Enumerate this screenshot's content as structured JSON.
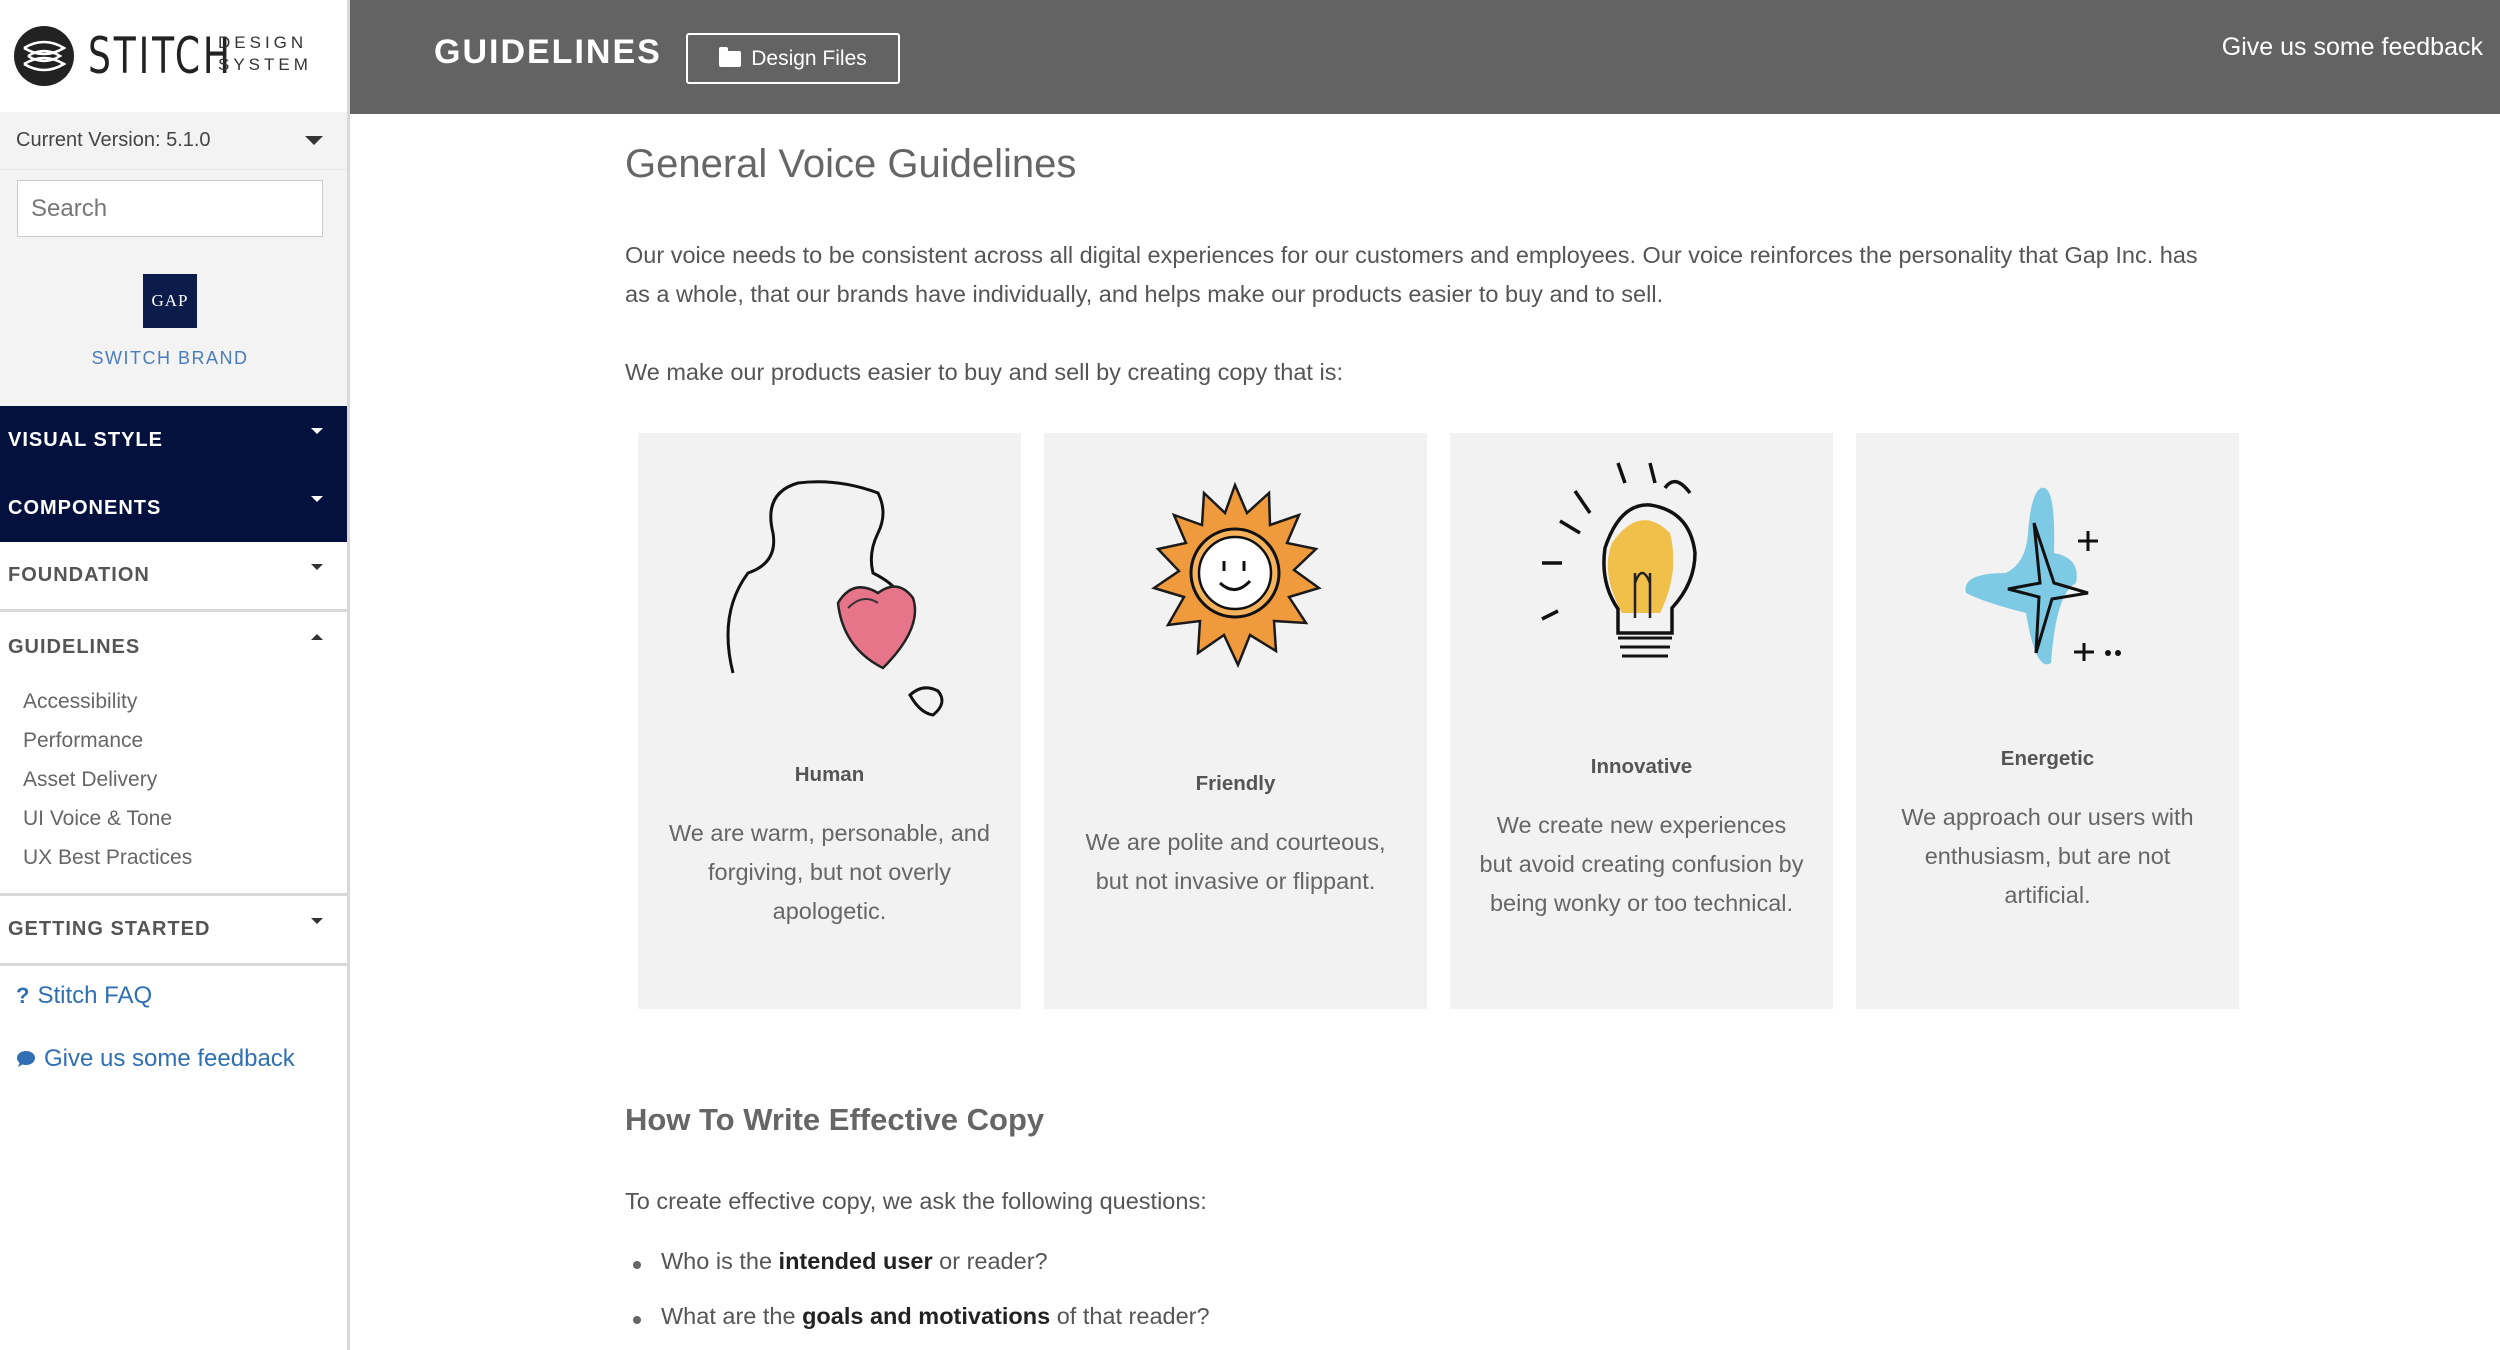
{
  "brand": {
    "name": "STITCH",
    "sub_line1": "DESIGN",
    "sub_line2": "SYSTEM",
    "logo_icon": "stitch-logo-icon"
  },
  "sidebar": {
    "version_label": "Current Version: 5.1.0",
    "search_placeholder": "Search",
    "brand_logo_text": "GAP",
    "switch_brand": "SWITCH BRAND",
    "nav_dark": [
      {
        "label": "VISUAL STYLE"
      },
      {
        "label": "COMPONENTS"
      }
    ],
    "foundation": "FOUNDATION",
    "guidelines": "GUIDELINES",
    "guidelines_items": [
      {
        "label": "Accessibility"
      },
      {
        "label": "Performance"
      },
      {
        "label": "Asset Delivery"
      },
      {
        "label": "UI Voice & Tone"
      },
      {
        "label": "UX Best Practices"
      }
    ],
    "getting_started": "GETTING STARTED",
    "faq_link": "Stitch FAQ",
    "feedback_link": "Give us some feedback",
    "faq_icon_glyph": "?",
    "colors": {
      "dark_nav": "#04103d",
      "link": "#2f6fb3"
    }
  },
  "header": {
    "title": "GUIDELINES",
    "design_files": "Design Files",
    "feedback": "Give us some feedback",
    "bg_color": "#636363"
  },
  "main": {
    "heading": "General Voice Guidelines",
    "intro": "Our voice needs to be consistent across all digital experiences for our customers and employees. Our voice reinforces the personality that Gap Inc. has as a whole, that our brands have individually, and helps make our products easier to buy and to sell.",
    "lead": "We make our products easier to buy and sell by creating copy that is:",
    "cards": [
      {
        "title": "Human",
        "desc": "We are warm, personable, and forgiving, but not overly apologetic.",
        "icon": "heart-person-icon"
      },
      {
        "title": "Friendly",
        "desc": "We are polite and courteous, but not invasive or flippant.",
        "icon": "smiling-sun-icon"
      },
      {
        "title": "Innovative",
        "desc": "We create new experiences but avoid creating confusion by being wonky or too technical.",
        "icon": "lightbulb-icon"
      },
      {
        "title": "Energetic",
        "desc": "We approach our users with enthusiasm, but are not artificial.",
        "icon": "sparkle-icon"
      }
    ],
    "heading2": "How To Write Effective Copy",
    "questions_lead": "To create effective copy, we ask the following questions:",
    "bullets": [
      {
        "pre": "Who is the ",
        "bold": "intended user",
        "post": " or reader?"
      },
      {
        "pre": "What are the ",
        "bold": "goals and motivations",
        "post": " of that reader?"
      }
    ]
  }
}
